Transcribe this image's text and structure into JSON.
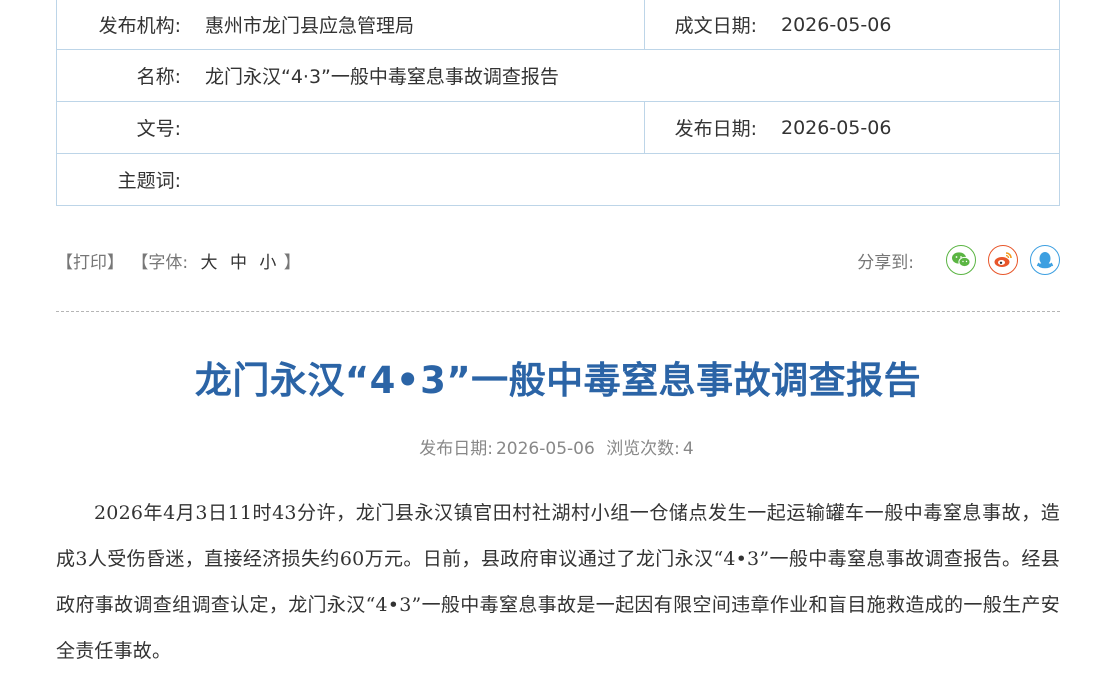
{
  "meta": {
    "publisher_label": "发布机构:",
    "publisher_value": "惠州市龙门县应急管理局",
    "written_date_label": "成文日期:",
    "written_date_value": "2026-05-06",
    "name_label": "名称:",
    "name_value": "龙门永汉“4·3”一般中毒窒息事故调查报告",
    "doc_no_label": "文号:",
    "doc_no_value": "",
    "publish_date_label": "发布日期:",
    "publish_date_value": "2026-05-06",
    "subject_label": "主题词:",
    "subject_value": ""
  },
  "toolbar": {
    "print": "【打印】",
    "font_prefix": "【字体:",
    "font_large": "大",
    "font_medium": "中",
    "font_small": "小",
    "font_suffix": "】",
    "share_label": "分享到:",
    "share_icons": [
      "wechat-icon",
      "weibo-icon",
      "qq-icon"
    ],
    "share_colors": {
      "wechat": "#5bb543",
      "weibo": "#e8562a",
      "qq": "#3c9fe1"
    }
  },
  "article": {
    "title": "龙门永汉“4•3”一般中毒窒息事故调查报告",
    "date_label": "发布日期:",
    "date_value": "2026-05-06",
    "views_label": "浏览次数:",
    "views_value": "4",
    "paragraph": "2026年4月3日11时43分许，龙门县永汉镇官田村社湖村小组一仓储点发生一起运输罐车一般中毒窒息事故，造成3人受伤昏迷，直接经济损失约60万元。日前，县政府审议通过了龙门永汉“4•3”一般中毒窒息事故调查报告。经县政府事故调查组调查认定，龙门永汉“4•3”一般中毒窒息事故是一起因有限空间违章作业和盲目施救造成的一般生产安全责任事故。"
  }
}
